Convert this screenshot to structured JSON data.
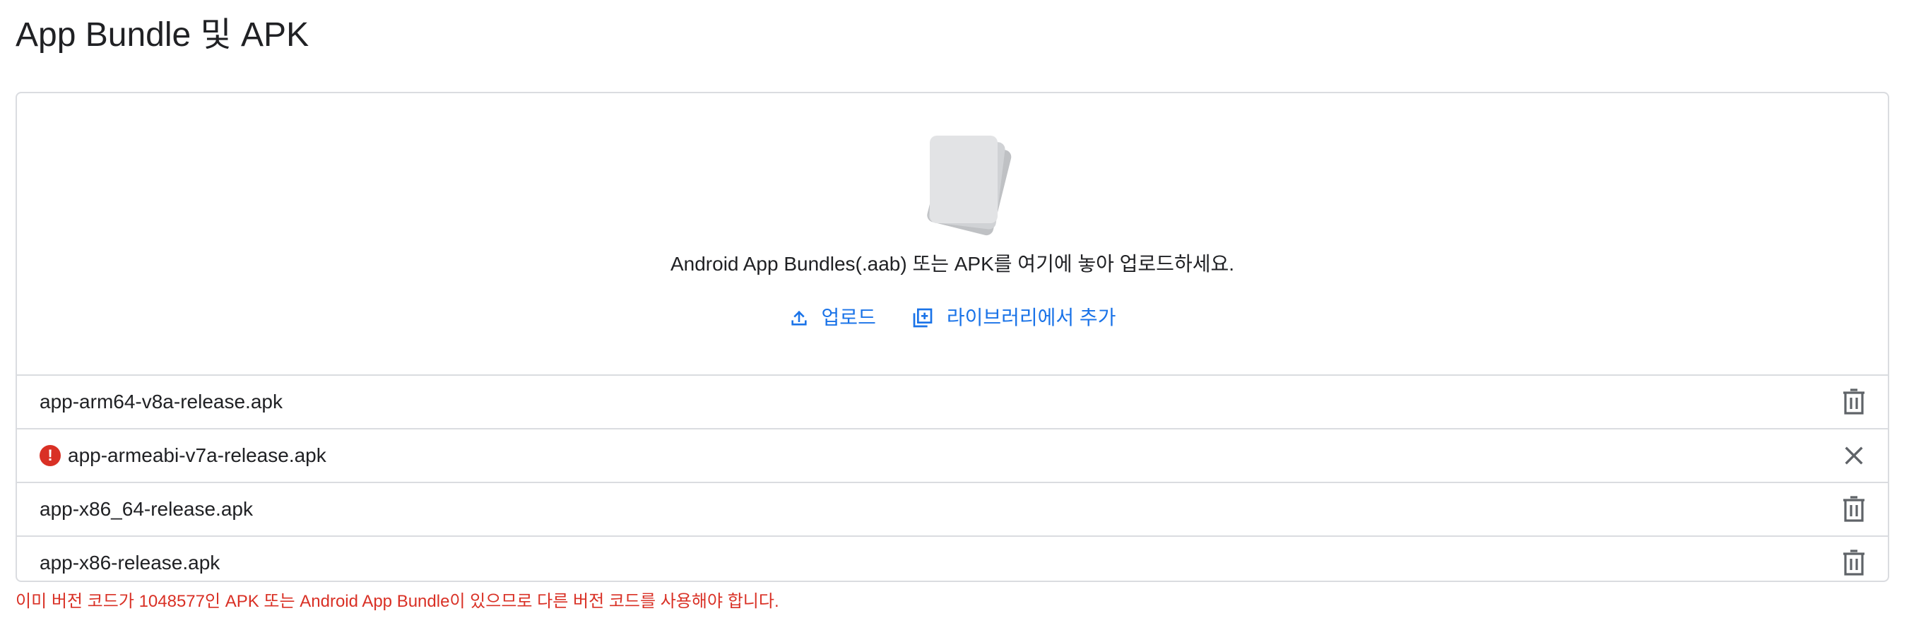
{
  "header": {
    "title": "App Bundle 및 APK"
  },
  "dropzone": {
    "illustration_icon": "stacked-documents-icon",
    "message": "Android App Bundles(.aab) 또는 APK를 여기에 놓아 업로드하세요.",
    "actions": [
      {
        "label": "업로드",
        "icon": "upload-icon"
      },
      {
        "label": "라이브러리에서 추가",
        "icon": "library-add-icon"
      }
    ]
  },
  "files": [
    {
      "name": "app-arm64-v8a-release.apk",
      "status": "ok",
      "action_icon": "delete-icon"
    },
    {
      "name": "app-armeabi-v7a-release.apk",
      "status": "error",
      "action_icon": "close-icon"
    },
    {
      "name": "app-x86_64-release.apk",
      "status": "ok",
      "action_icon": "delete-icon"
    },
    {
      "name": "app-x86-release.apk",
      "status": "ok",
      "action_icon": "delete-icon"
    }
  ],
  "error": {
    "message": "이미 버전 코드가 1048577인 APK 또는 Android App Bundle이 있으므로 다른 버전 코드를 사용해야 합니다.",
    "error_icon_glyph": "!"
  },
  "colors": {
    "accent": "#1a73e8",
    "error": "#d93025",
    "border": "#dadce0",
    "text": "#202124",
    "icon": "#5f6368"
  }
}
